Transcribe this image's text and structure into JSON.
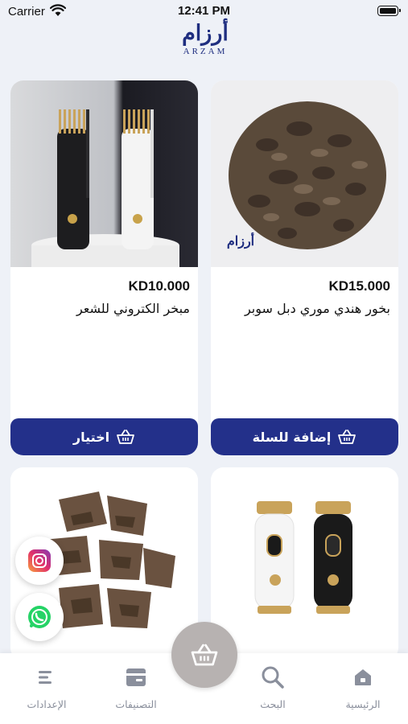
{
  "status_bar": {
    "carrier": "Carrier",
    "time": "12:41 PM"
  },
  "logo": {
    "arabic": "أرزام",
    "english": "ARZAM"
  },
  "products": [
    {
      "price": "KD10.000",
      "name": "مبخر الكتروني للشعر",
      "button": "اختيار"
    },
    {
      "price": "KD15.000",
      "name": "بخور هندي موري دبل سوبر",
      "button": "إضافة للسلة"
    }
  ],
  "tabbar": {
    "settings": "الإعدادات",
    "categories": "التصنيفات",
    "search": "البحث",
    "home": "الرئيسية"
  },
  "colors": {
    "primary": "#23308a",
    "accent_gold": "#c8a24a",
    "background": "#eef1f7"
  }
}
